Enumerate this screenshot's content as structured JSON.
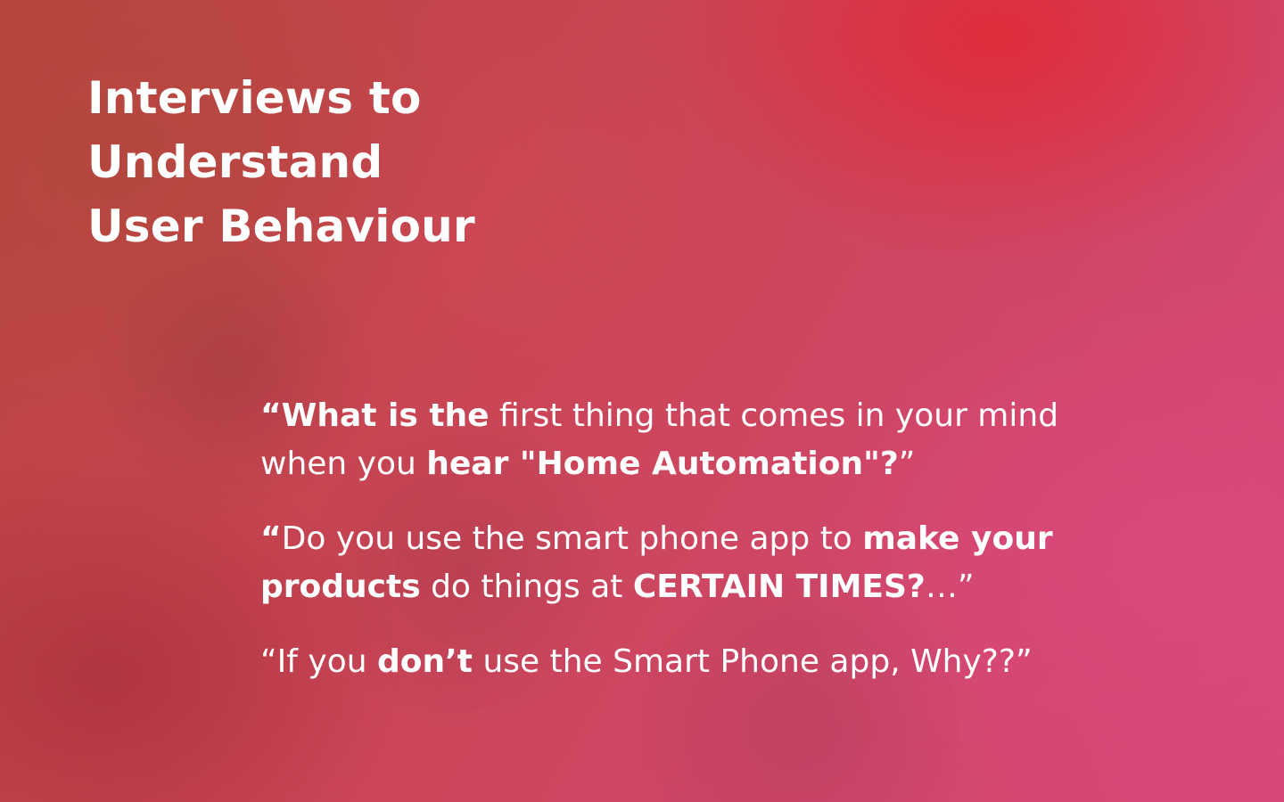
{
  "title": {
    "lines": [
      "Interviews to",
      "Understand",
      "User Behaviour"
    ]
  },
  "quotes": [
    {
      "line1": [
        {
          "text": "“What is the",
          "bold": true
        },
        {
          "text": " first thing that comes in your mind",
          "bold": false
        }
      ],
      "line2": [
        {
          "text": "when you ",
          "bold": false
        },
        {
          "text": "hear \"Home Automation\"?",
          "bold": true
        },
        {
          "text": "”",
          "bold": false
        }
      ]
    },
    {
      "line1": [
        {
          "text": "“",
          "bold": true
        },
        {
          "text": "Do you use the smart phone app to ",
          "bold": false
        },
        {
          "text": "make your",
          "bold": true
        }
      ],
      "line2": [
        {
          "text": "products",
          "bold": true
        },
        {
          "text": " do things at ",
          "bold": false
        },
        {
          "text": "CERTAIN TIMES?",
          "bold": true
        },
        {
          "text": "…”",
          "bold": false
        }
      ]
    },
    {
      "line1": [
        {
          "text": "“If you ",
          "bold": false
        },
        {
          "text": "don’t",
          "bold": true
        },
        {
          "text": " use the Smart Phone app, Why??”",
          "bold": false
        }
      ]
    }
  ],
  "colors": {
    "text": "#ffffff",
    "accent_red": "#e2283a",
    "accent_pink": "#dc4a7e"
  }
}
